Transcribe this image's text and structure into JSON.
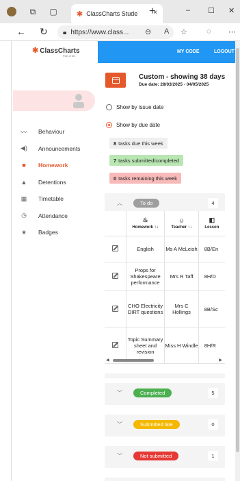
{
  "browser": {
    "tab_title": "ClassCharts Stude",
    "tab_close": "×",
    "new_tab": "+",
    "url": "https://www.class...",
    "minimize": "–",
    "maximize": "☐",
    "close": "✕"
  },
  "app": {
    "logo_text": "ClassCharts",
    "logo_sub": "Part of tes",
    "my_code": "MY CODE",
    "logout": "LOGOUT",
    "accent": "#e5582c",
    "topbar_color": "#2196f3"
  },
  "sidebar": {
    "items": [
      {
        "label": "Behaviour",
        "icon": "trend-icon"
      },
      {
        "label": "Announcements",
        "icon": "megaphone-icon"
      },
      {
        "label": "Homework",
        "icon": "briefcase-icon"
      },
      {
        "label": "Detentions",
        "icon": "warning-icon"
      },
      {
        "label": "Timetable",
        "icon": "calendar-grid-icon"
      },
      {
        "label": "Attendance",
        "icon": "clock-icon"
      },
      {
        "label": "Badges",
        "icon": "star-icon"
      }
    ]
  },
  "main": {
    "title": "Custom - showing 38 days",
    "dates": "Due date: 28/03/2025 - 04/05/2025",
    "radio_issue": "Show by issue date",
    "radio_due": "Show by due date",
    "stat_due_num": "8",
    "stat_due_text": "tasks due this week",
    "stat_submitted_num": "7",
    "stat_submitted_text": "tasks submitted/completed",
    "stat_remaining_num": "0",
    "stat_remaining_text": "tasks remaining this week"
  },
  "todo": {
    "label": "To do",
    "count": "4",
    "columns": [
      "Homework",
      "Teacher",
      "Lesson"
    ],
    "rows": [
      {
        "homework": "English",
        "teacher": "Ms A McLeish",
        "lesson": "8B/En"
      },
      {
        "homework": "Props for Shakespeare performance",
        "teacher": "Mrs R Taff",
        "lesson": "8H/D"
      },
      {
        "homework": "CHO Electricity DIRT questions",
        "teacher": "Mrs C Hollings",
        "lesson": "8B/Sc"
      },
      {
        "homework": "Topic Summary sheet and revision",
        "teacher": "Miss H Windle",
        "lesson": "8H/R"
      }
    ]
  },
  "completed": {
    "label": "Completed",
    "count": "5"
  },
  "submitted_late": {
    "label": "Submitted late",
    "count": "0"
  },
  "not_submitted": {
    "label": "Not submitted",
    "count": "1"
  }
}
